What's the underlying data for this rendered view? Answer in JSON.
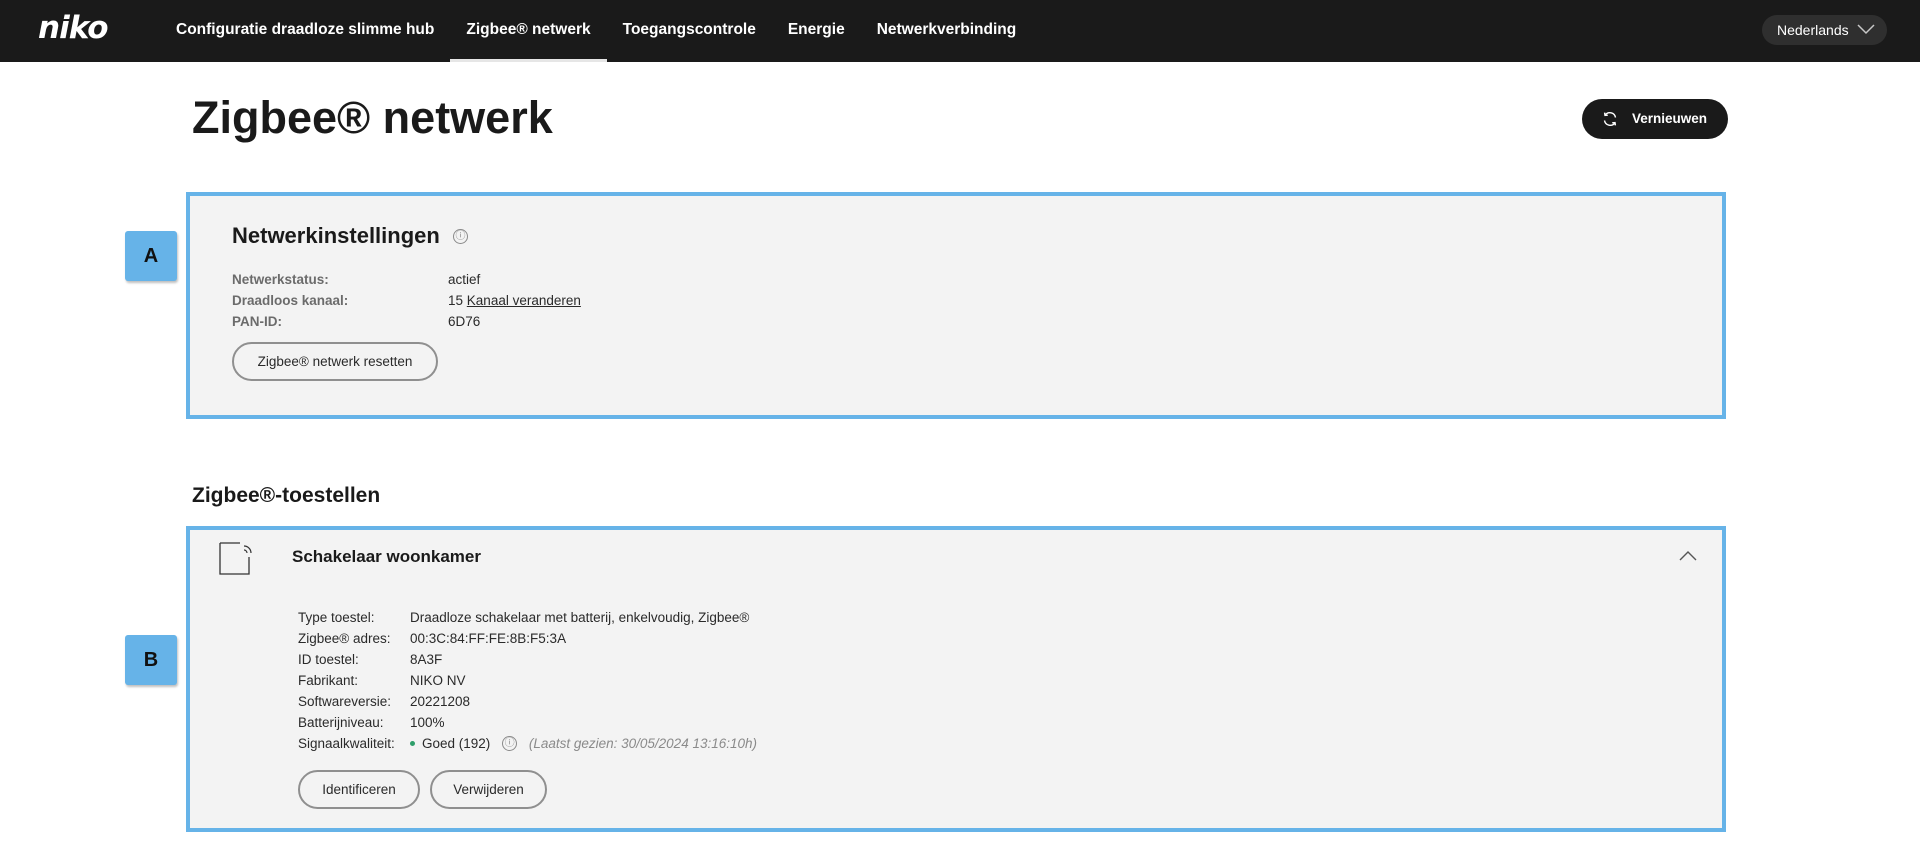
{
  "brand": {
    "logo_text": "niko"
  },
  "nav": {
    "items": [
      {
        "label": "Configuratie draadloze slimme hub",
        "active": false
      },
      {
        "label": "Zigbee® netwerk",
        "active": true
      },
      {
        "label": "Toegangscontrole",
        "active": false
      },
      {
        "label": "Energie",
        "active": false
      },
      {
        "label": "Netwerkverbinding",
        "active": false
      }
    ],
    "language": "Nederlands"
  },
  "header": {
    "title": "Zigbee® netwerk",
    "refresh_label": "Vernieuwen"
  },
  "markers": {
    "a": "A",
    "b": "B"
  },
  "network_settings": {
    "title": "Netwerkinstellingen",
    "info_icon": "ⓘ",
    "rows": [
      {
        "label": "Netwerkstatus:",
        "value": "actief"
      },
      {
        "label": "Draadloos kanaal:",
        "value": "15",
        "link": "Kanaal veranderen"
      },
      {
        "label": "PAN-ID:",
        "value": "6D76"
      }
    ],
    "reset_button": "Zigbee® netwerk resetten"
  },
  "devices": {
    "heading": "Zigbee®-toestellen",
    "items": [
      {
        "name": "Schakelaar woonkamer",
        "icon": "wireless-switch-icon",
        "details": [
          {
            "label": "Type toestel:",
            "value": "Draadloze schakelaar met batterij, enkelvoudig, Zigbee®"
          },
          {
            "label": "Zigbee® adres:",
            "value": "00:3C:84:FF:FE:8B:F5:3A"
          },
          {
            "label": "ID toestel:",
            "value": "8A3F"
          },
          {
            "label": "Fabrikant:",
            "value": "NIKO NV"
          },
          {
            "label": "Softwareversie:",
            "value": "20221208"
          },
          {
            "label": "Batterijniveau:",
            "value": "100%"
          }
        ],
        "signal": {
          "label": "Signaalkwaliteit:",
          "value": "Goed (192)",
          "last_seen": "(Laatst gezien: 30/05/2024 13:16:10h)",
          "status_color": "#2e9e6a"
        },
        "buttons": {
          "identify": "Identificeren",
          "remove": "Verwijderen"
        }
      }
    ]
  },
  "colors": {
    "topbar": "#1a1a1a",
    "highlight_border": "#66b3e8",
    "panel_bg": "#f3f3f3"
  }
}
